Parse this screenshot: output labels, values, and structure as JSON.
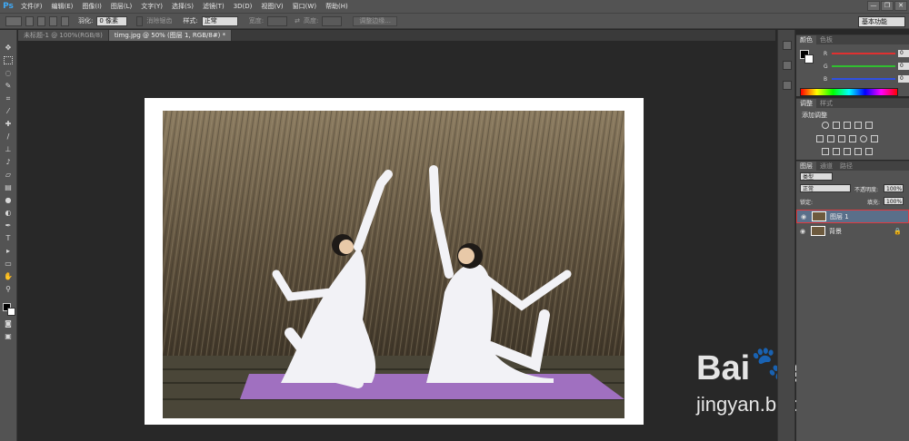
{
  "app": {
    "logo": "Ps"
  },
  "menu": [
    "文件(F)",
    "编辑(E)",
    "图像(I)",
    "图层(L)",
    "文字(Y)",
    "选择(S)",
    "滤镜(T)",
    "3D(D)",
    "视图(V)",
    "窗口(W)",
    "帮助(H)"
  ],
  "window_buttons": [
    "—",
    "❐",
    "✕"
  ],
  "options": {
    "feather_label": "羽化:",
    "feather_value": "0 像素",
    "antialias_label": "消除锯齿",
    "style_label": "样式:",
    "style_value": "正常",
    "width_label": "宽度:",
    "height_label": "高度:",
    "refine_edge": "调整边缘...",
    "workspace": "基本功能"
  },
  "tabs": [
    {
      "label": "未标题-1 @ 100%(RGB/8)"
    },
    {
      "label": "timg.jpg @ 50% (图层 1, RGB/8#) *"
    }
  ],
  "color_panel": {
    "tabs": [
      "颜色",
      "色板"
    ],
    "rows": [
      {
        "letter": "R",
        "value": "0",
        "color": "#e03030"
      },
      {
        "letter": "G",
        "value": "0",
        "color": "#30c030"
      },
      {
        "letter": "B",
        "value": "0",
        "color": "#3050e0"
      }
    ]
  },
  "adjust_panel": {
    "tabs": [
      "调整",
      "样式"
    ],
    "title": "添加调整"
  },
  "layers_panel": {
    "tabs": [
      "图层",
      "通道",
      "路径"
    ],
    "kind_label": "类型",
    "blend_mode": "正常",
    "opacity_label": "不透明度:",
    "opacity_value": "100%",
    "lock_label": "锁定:",
    "fill_label": "填充:",
    "fill_value": "100%",
    "layers": [
      {
        "name": "图层 1",
        "selected": true
      },
      {
        "name": "背景",
        "selected": false
      }
    ]
  },
  "watermark": {
    "brand": "Bai",
    "brand_cn": "经验",
    "url": "jingyan.baidu.com"
  }
}
